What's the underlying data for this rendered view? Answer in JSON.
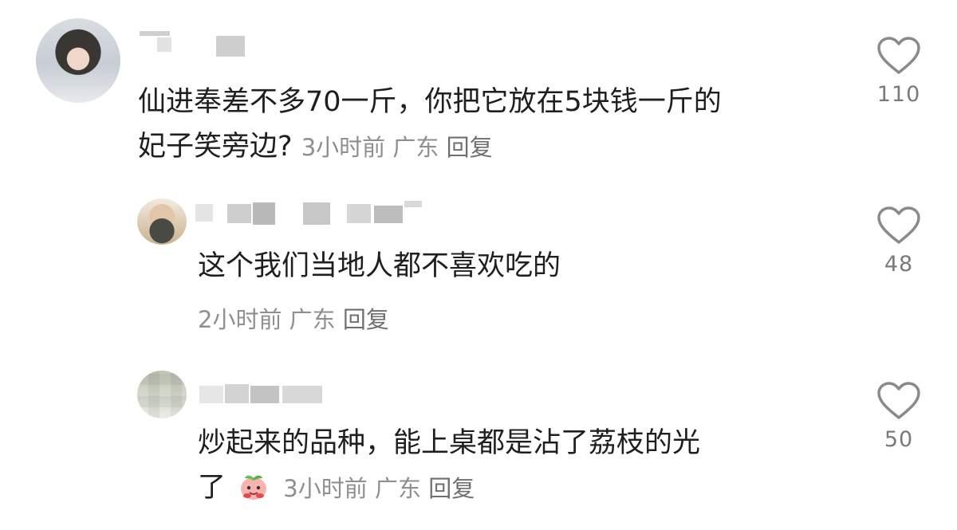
{
  "comments": [
    {
      "text_line1": "仙进奉差不多70一斤，你把它放在5块钱一斤的",
      "text_line2": "妃子笑旁边?",
      "time": "3小时前",
      "location": "广东",
      "reply": "回复",
      "likes": "110"
    },
    {
      "text": "这个我们当地人都不喜欢吃的",
      "time": "2小时前",
      "location": "广东",
      "reply": "回复",
      "likes": "48"
    },
    {
      "text_line1": "炒起来的品种，能上桌都是沾了荔枝的光",
      "text_line2": "了",
      "time": "3小时前",
      "location": "广东",
      "reply": "回复",
      "likes": "50"
    }
  ],
  "icons": {
    "like": "heart-outline-icon",
    "emoji": "peach-emoji-icon"
  },
  "colors": {
    "text": "#1f1f1f",
    "meta": "#8f8f8f",
    "icon": "#8a8a8a"
  }
}
